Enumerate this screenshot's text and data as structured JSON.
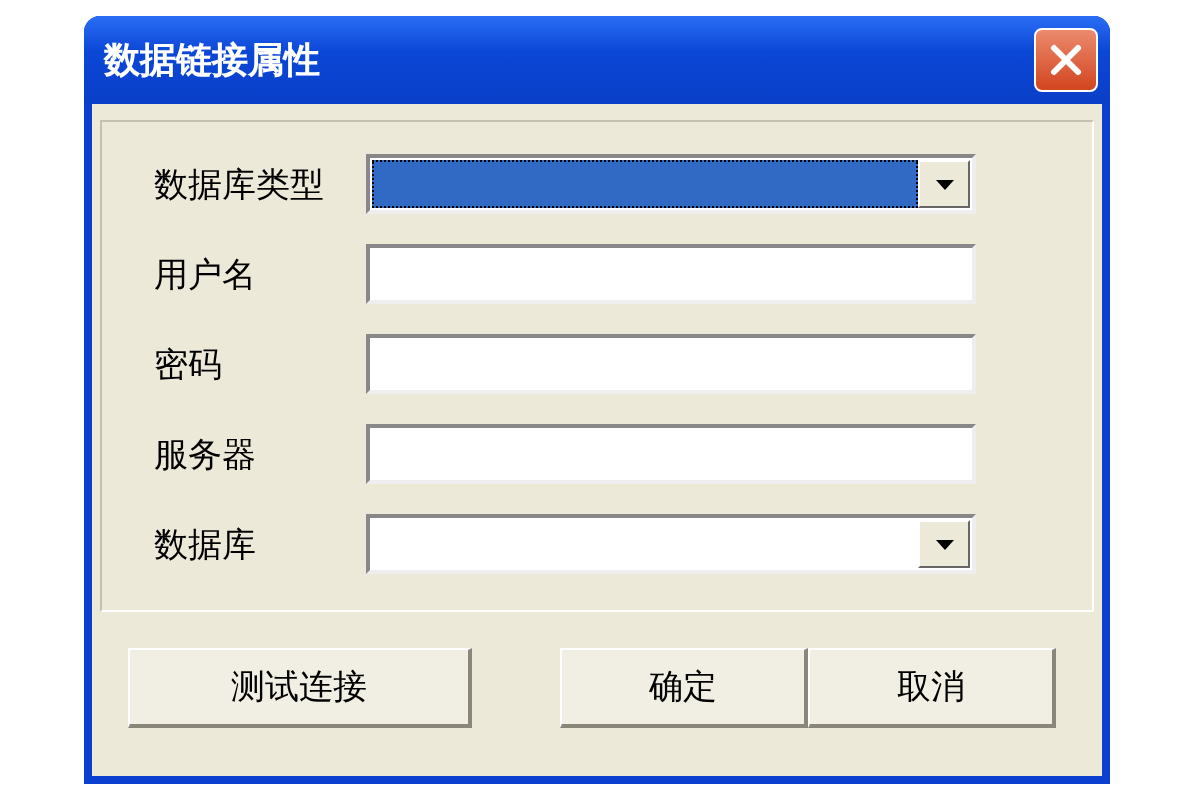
{
  "window": {
    "title": "数据链接属性"
  },
  "fields": [
    {
      "label": "数据库类型",
      "kind": "dropdown",
      "focused": true
    },
    {
      "label": "用户名",
      "kind": "text",
      "focused": false
    },
    {
      "label": "密码",
      "kind": "text",
      "focused": false
    },
    {
      "label": "服务器",
      "kind": "text",
      "focused": false
    },
    {
      "label": "数据库",
      "kind": "dropdown",
      "focused": false
    }
  ],
  "buttons": [
    {
      "label": "测试连接"
    },
    {
      "label": "确定"
    },
    {
      "label": "取消"
    }
  ]
}
